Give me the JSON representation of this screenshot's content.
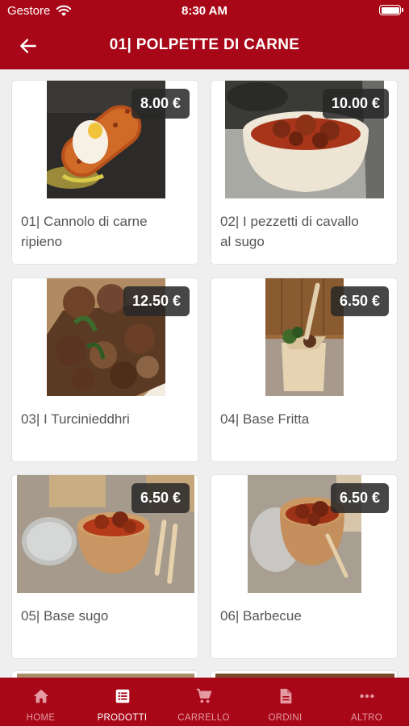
{
  "status": {
    "carrier": "Gestore",
    "time": "8:30 AM"
  },
  "header": {
    "title": "01| POLPETTE DI CARNE"
  },
  "products": [
    {
      "name": "01| Cannolo di carne ripieno",
      "price": "8.00 €"
    },
    {
      "name": "02| I pezzetti di cavallo al sugo",
      "price": "10.00 €"
    },
    {
      "name": "03| I Turcinieddhri",
      "price": "12.50 €"
    },
    {
      "name": "04| Base Fritta",
      "price": "6.50 €"
    },
    {
      "name": "05| Base sugo",
      "price": "6.50 €"
    },
    {
      "name": "06| Barbecue",
      "price": "6.50 €"
    }
  ],
  "tabs": [
    {
      "label": "HOME",
      "icon": "home-icon"
    },
    {
      "label": "PRODOTTI",
      "icon": "list-icon",
      "active": true
    },
    {
      "label": "CARRELLO",
      "icon": "cart-icon"
    },
    {
      "label": "ORDINI",
      "icon": "document-icon"
    },
    {
      "label": "ALTRO",
      "icon": "more-icon"
    }
  ],
  "colors": {
    "brand": "#a80717",
    "tab_inactive": "#e59aa3",
    "price_badge": "#2b2b2b"
  }
}
